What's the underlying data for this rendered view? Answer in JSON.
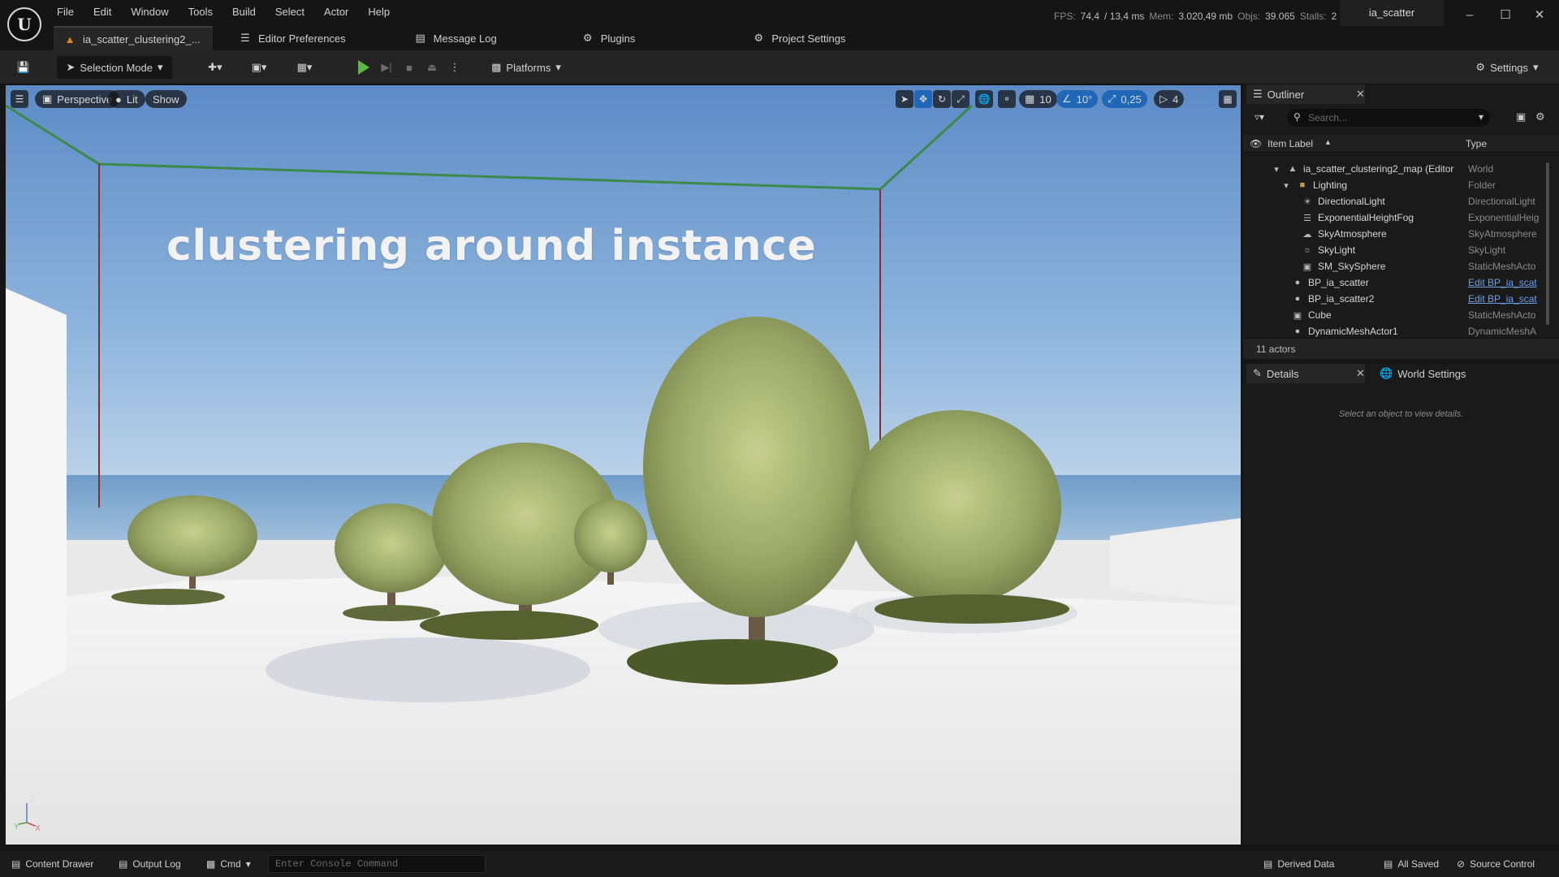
{
  "menu": [
    "File",
    "Edit",
    "Window",
    "Tools",
    "Build",
    "Select",
    "Actor",
    "Help"
  ],
  "stats": {
    "fps_label": "FPS:",
    "fps": "74,4",
    "ms": "/ 13,4 ms",
    "mem_label": "Mem:",
    "mem": "3.020,49 mb",
    "objs_label": "Objs:",
    "objs": "39.065",
    "stalls_label": "Stalls:",
    "stalls": "2"
  },
  "project_name": "ia_scatter",
  "tabs": [
    {
      "label": "ia_scatter_clustering2_...",
      "icon": "level-icon"
    },
    {
      "label": "Editor Preferences",
      "icon": "sliders-icon"
    },
    {
      "label": "Message Log",
      "icon": "log-icon"
    },
    {
      "label": "Plugins",
      "icon": "plug-icon"
    },
    {
      "label": "Project Settings",
      "icon": "settings-gear-icon"
    }
  ],
  "toolbar": {
    "selection_mode": "Selection Mode",
    "platforms": "Platforms",
    "settings": "Settings"
  },
  "viewport": {
    "perspective": "Perspective",
    "lit": "Lit",
    "show": "Show",
    "grid_snap": "10",
    "rotation_snap": "10°",
    "scale_snap": "0,25",
    "camera_speed": "4",
    "scene_text": "clustering around instance",
    "axis_z": "Z",
    "axis_x": "X",
    "axis_y": "Y"
  },
  "outliner": {
    "title": "Outliner",
    "search_placeholder": "Search...",
    "col_label": "Item Label",
    "col_type": "Type",
    "items": [
      {
        "label": "ia_scatter_clustering2_map (Editor",
        "type": "World"
      },
      {
        "label": "Lighting",
        "type": "Folder"
      },
      {
        "label": "DirectionalLight",
        "type": "DirectionalLight"
      },
      {
        "label": "ExponentialHeightFog",
        "type": "ExponentialHeig"
      },
      {
        "label": "SkyAtmosphere",
        "type": "SkyAtmosphere"
      },
      {
        "label": "SkyLight",
        "type": "SkyLight"
      },
      {
        "label": "SM_SkySphere",
        "type": "StaticMeshActo"
      },
      {
        "label": "BP_ia_scatter",
        "type": "Edit BP_ia_scat"
      },
      {
        "label": "BP_ia_scatter2",
        "type": "Edit BP_ia_scat"
      },
      {
        "label": "Cube",
        "type": "StaticMeshActo"
      },
      {
        "label": "DynamicMeshActor1",
        "type": "DynamicMeshA"
      }
    ],
    "footer": "11 actors"
  },
  "details": {
    "title": "Details",
    "world_settings": "World Settings",
    "hint": "Select an object to view details."
  },
  "statusbar": {
    "content_drawer": "Content Drawer",
    "output_log": "Output Log",
    "cmd": "Cmd",
    "console_placeholder": "Enter Console Command",
    "derived_data": "Derived Data",
    "all_saved": "All Saved",
    "source_control": "Source Control"
  },
  "colors": {
    "accent_blue": "#2167b8",
    "play_green": "#5cb842",
    "level_orange": "#d98a1c",
    "link_blue": "#6aa0e8"
  }
}
